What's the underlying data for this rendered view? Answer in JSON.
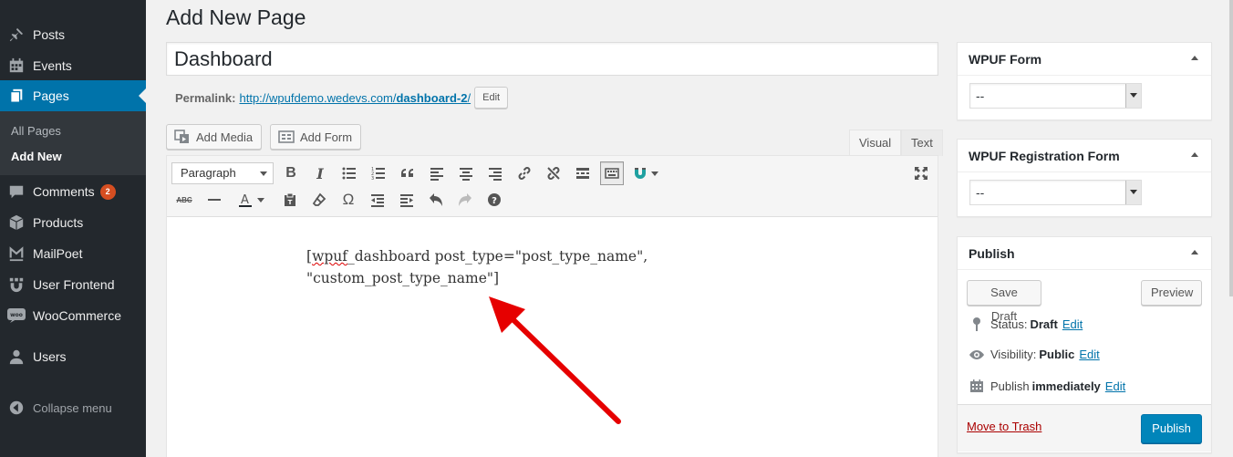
{
  "sidebar": {
    "items": [
      {
        "label": "Posts",
        "icon": "pin-icon"
      },
      {
        "label": "Events",
        "icon": "calendar-icon"
      },
      {
        "label": "Pages",
        "icon": "pages-icon"
      },
      {
        "label": "Comments",
        "icon": "comment-icon",
        "badge": "2"
      },
      {
        "label": "Products",
        "icon": "box-icon"
      },
      {
        "label": "MailPoet",
        "icon": "mailpoet-icon"
      },
      {
        "label": "User Frontend",
        "icon": "user-frontend-icon"
      },
      {
        "label": "WooCommerce",
        "icon": "woo-icon"
      },
      {
        "label": "Users",
        "icon": "user-icon"
      }
    ],
    "submenu": [
      "All Pages",
      "Add New"
    ],
    "collapse": "Collapse menu"
  },
  "page": {
    "title": "Add New Page",
    "post_title": "Dashboard",
    "permalink_label": "Permalink:",
    "permalink_base": "http://wpufdemo.wedevs.com/",
    "permalink_slug": "dashboard-2",
    "permalink_trail": "/",
    "edit_label": "Edit"
  },
  "editor": {
    "add_media": "Add Media",
    "add_form": "Add Form",
    "tab_visual": "Visual",
    "tab_text": "Text",
    "format": "Paragraph",
    "content_open": "[",
    "content_squiggle": "wpuf",
    "content_line1_rest": "_dashboard post_type=\"post_type_name\",",
    "content_line2": "\"custom_post_type_name\"]"
  },
  "wpuf_form": {
    "title": "WPUF Form",
    "selected": "--"
  },
  "wpuf_reg_form": {
    "title": "WPUF Registration Form",
    "selected": "--"
  },
  "publish": {
    "title": "Publish",
    "save_draft": "Save Draft",
    "preview": "Preview",
    "status_label": "Status:",
    "status_value": "Draft",
    "visibility_label": "Visibility:",
    "visibility_value": "Public",
    "publish_label": "Publish",
    "publish_value": "immediately",
    "edit": "Edit",
    "trash": "Move to Trash",
    "publish_button": "Publish"
  },
  "colors": {
    "accent": "#0073aa",
    "primary_button": "#0085ba",
    "sidebar": "#23282d",
    "arrow": "#e60000",
    "badge": "#d54e21"
  }
}
